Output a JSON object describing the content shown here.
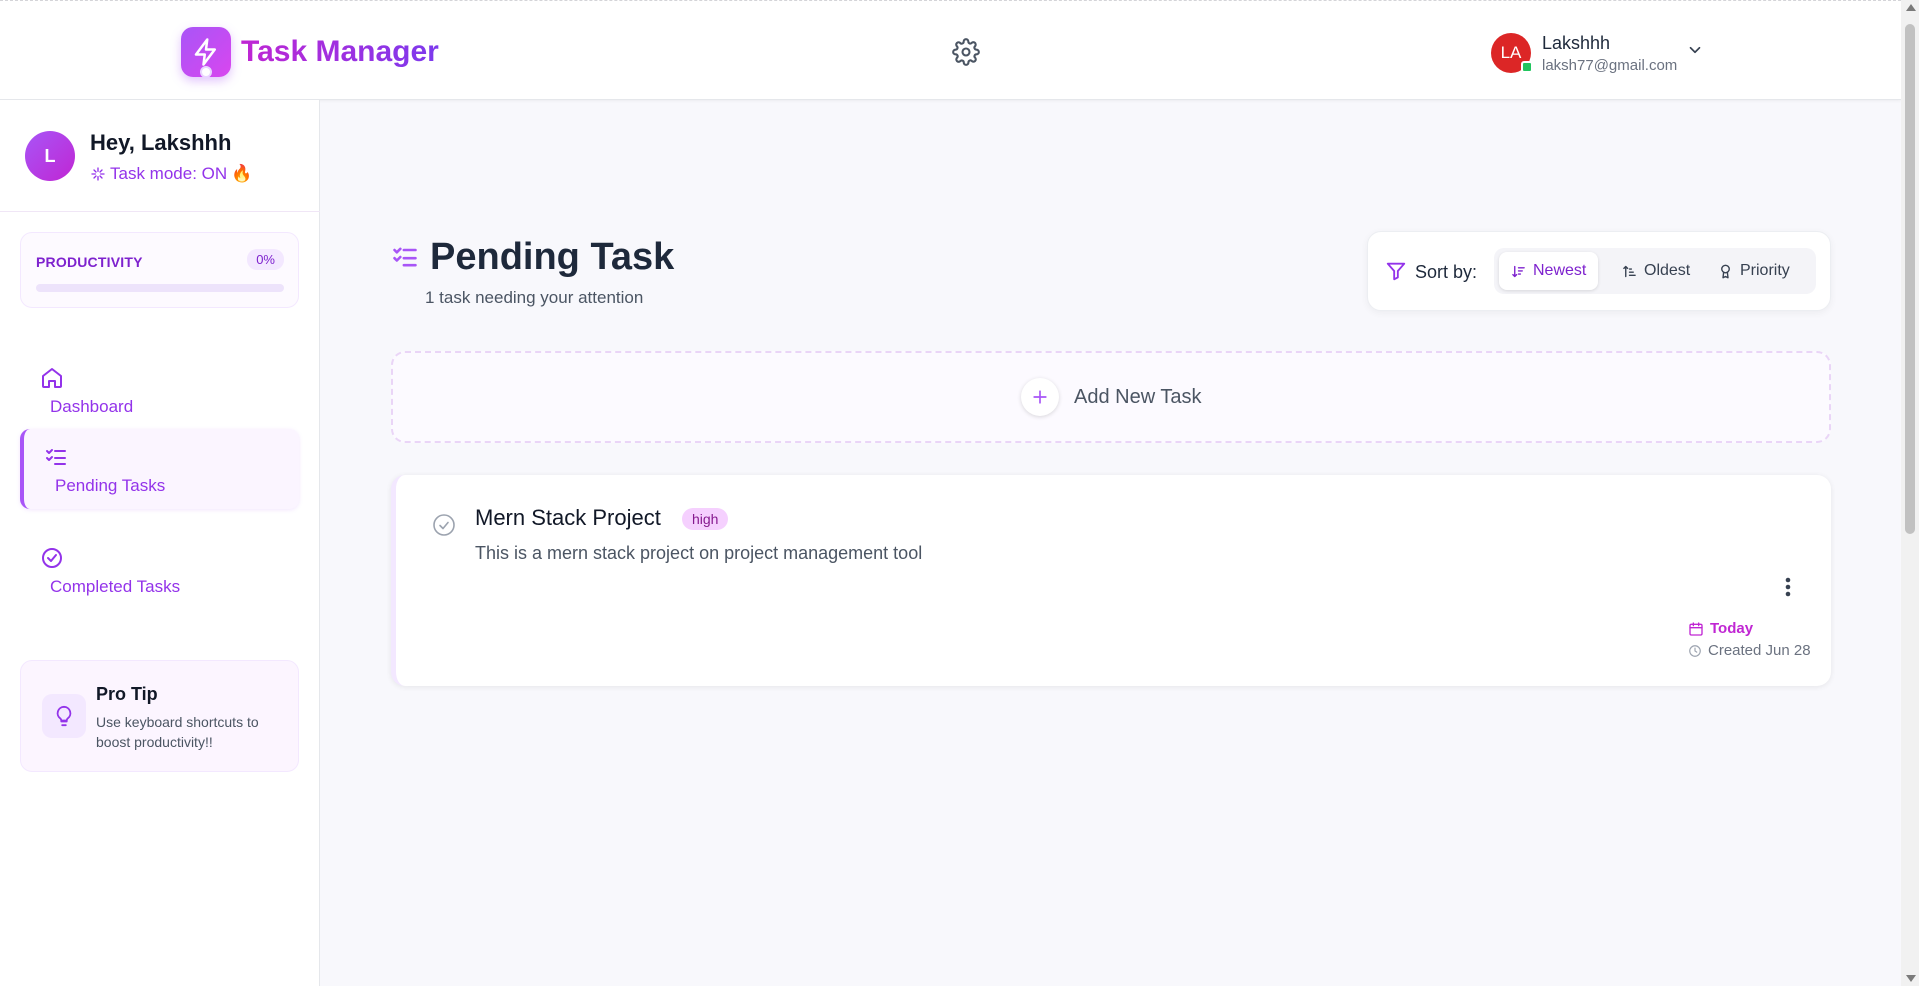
{
  "header": {
    "app_title": "Task Manager",
    "user": {
      "initials": "LA",
      "name": "Lakshhh",
      "email": "laksh77@gmail.com"
    }
  },
  "sidebar": {
    "greeting": {
      "initial": "L",
      "name": "Hey, Lakshhh",
      "mode": "Task mode: ON",
      "mode_emoji": "🔥"
    },
    "productivity": {
      "label": "PRODUCTIVITY",
      "percent_text": "0%",
      "progress": 0
    },
    "nav": [
      {
        "label": "Dashboard",
        "icon": "home-icon",
        "active": false
      },
      {
        "label": "Pending Tasks",
        "icon": "list-check-icon",
        "active": true
      },
      {
        "label": "Completed Tasks",
        "icon": "check-circle-icon",
        "active": false
      }
    ],
    "tip": {
      "title": "Pro Tip",
      "text": "Use keyboard shortcuts to boost productivity!!"
    }
  },
  "main": {
    "title": "Pending Task",
    "subtitle": "1 task needing your attention",
    "sort": {
      "label": "Sort by:",
      "options": [
        {
          "label": "Newest",
          "active": true
        },
        {
          "label": "Oldest",
          "active": false
        },
        {
          "label": "Priority",
          "active": false
        }
      ]
    },
    "add_task_label": "Add New Task",
    "tasks": [
      {
        "title": "Mern Stack Project",
        "priority": "high",
        "description": "This is a mern stack project on project management tool",
        "due": "Today",
        "created": "Created Jun 28"
      }
    ]
  },
  "colors": {
    "accent": "#a855f7",
    "accent_dark": "#7e22ce",
    "avatar_red": "#dc2626",
    "online": "#22c55e"
  }
}
